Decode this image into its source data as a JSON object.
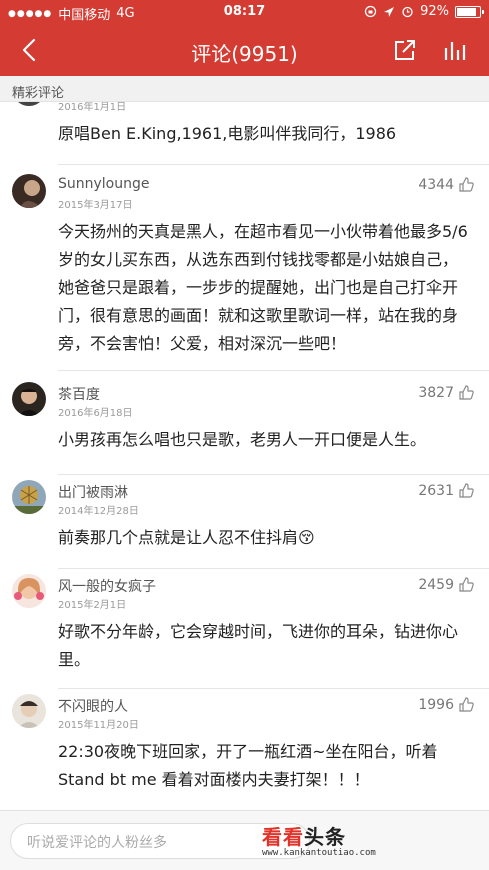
{
  "status_bar": {
    "carrier": "中国移动",
    "network": "4G",
    "time": "08:17",
    "battery": "92%",
    "battery_level": 0.92
  },
  "nav": {
    "title": "评论(9951)"
  },
  "section": {
    "label": "精彩评论"
  },
  "comments": [
    {
      "user": "",
      "date": "2016年1月1日",
      "likes": "",
      "text": "原唱Ben E.King,1961,电影叫伴我同行，1986"
    },
    {
      "user": "Sunnylounge",
      "date": "2015年3月17日",
      "likes": "4344",
      "text": "今天扬州的天真是黑人，在超市看见一小伙带着他最多5/6岁的女儿买东西，从选东西到付钱找零都是小姑娘自己，她爸爸只是跟着，一步步的提醒她，出门也是自己打伞开门，很有意思的画面！就和这歌里歌词一样，站在我的身旁，不会害怕！父爱，相对深沉一些吧！"
    },
    {
      "user": "茶百度",
      "date": "2016年6月18日",
      "likes": "3827",
      "text": "小男孩再怎么唱也只是歌，老男人一开口便是人生。"
    },
    {
      "user": "出门被雨淋",
      "date": "2014年12月28日",
      "likes": "2631",
      "text": "前奏那几个点就是让人忍不住抖肩😚"
    },
    {
      "user": "风一般的女疯子",
      "date": "2015年2月1日",
      "likes": "2459",
      "text": "好歌不分年龄，它会穿越时间，飞进你的耳朵，钻进你心里。"
    },
    {
      "user": "不闪眼的人",
      "date": "2015年11月20日",
      "likes": "1996",
      "text": "22:30夜晚下班回家，开了一瓶红酒~坐在阳台，听着Stand bt me 看着对面楼内夫妻打架！！！"
    }
  ],
  "input": {
    "placeholder": "听说爱评论的人粉丝多"
  },
  "watermark": {
    "red": "看看",
    "black": "头条",
    "url": "www.kankantoutiao.com"
  },
  "colors": {
    "brand_red": "#d43c33"
  },
  "icons": [
    "back-arrow-icon",
    "share-icon",
    "bar-chart-icon",
    "thumbs-up-icon",
    "alarm-icon",
    "location-icon",
    "lock-rotation-icon"
  ]
}
